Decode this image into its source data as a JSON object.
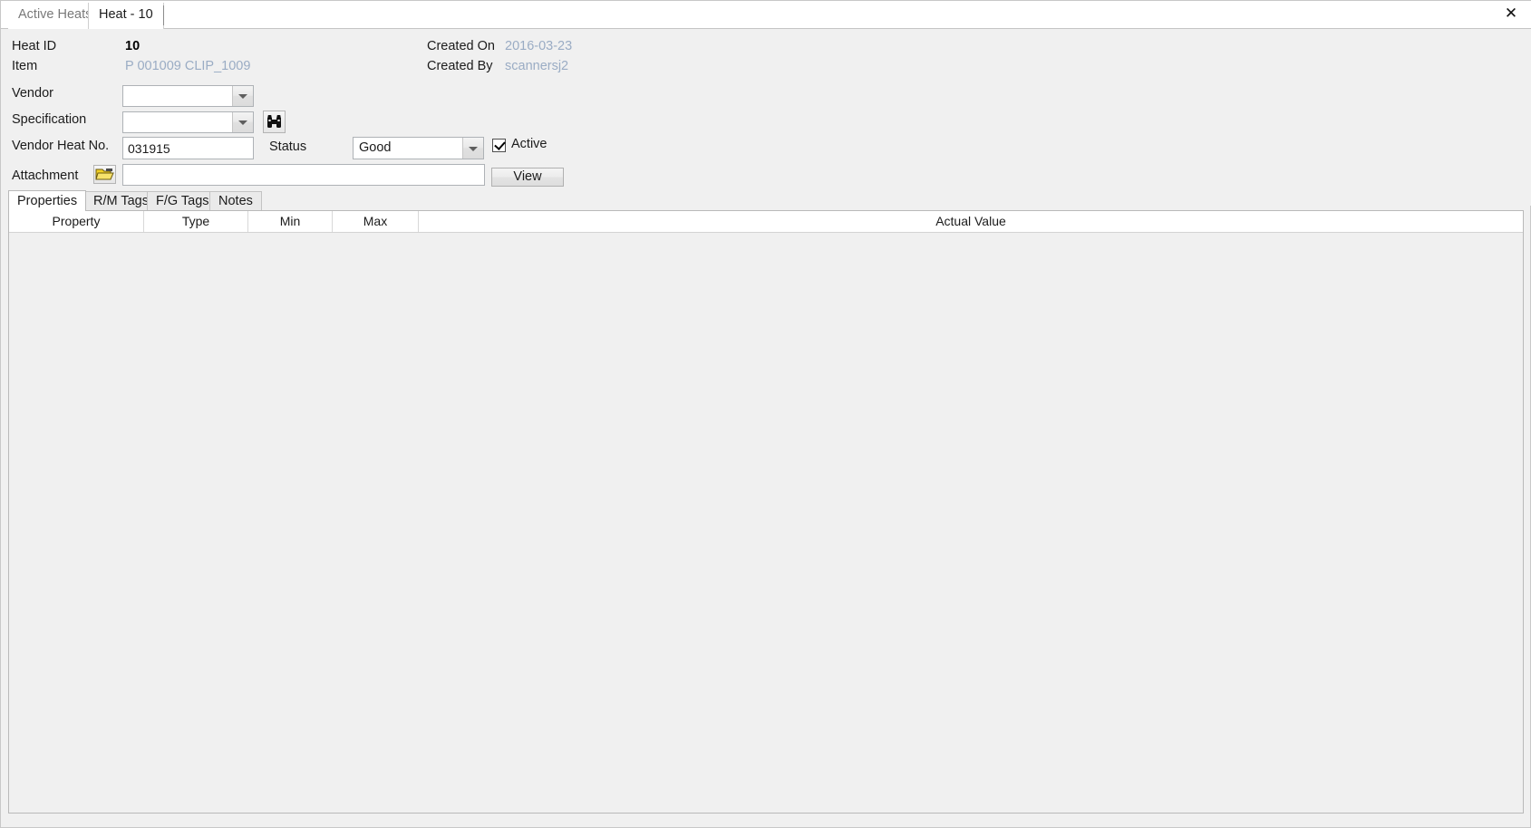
{
  "window": {
    "close_label": "✕"
  },
  "doc_tabs": [
    {
      "label": "Active Heats",
      "active": false
    },
    {
      "label": "Heat - 10",
      "active": true
    }
  ],
  "header": {
    "heat_id_label": "Heat ID",
    "heat_id_value": "10",
    "item_label": "Item",
    "item_value": "P 001009 CLIP_1009",
    "created_on_label": "Created On",
    "created_on_value": "2016-03-23",
    "created_by_label": "Created By",
    "created_by_value": "scannersj2"
  },
  "form": {
    "vendor_label": "Vendor",
    "vendor_value": "",
    "specification_label": "Specification",
    "specification_value": "",
    "specification_search_icon": "binoculars-icon",
    "vendor_heat_no_label": "Vendor Heat No.",
    "vendor_heat_no_value": "031915",
    "status_label": "Status",
    "status_value": "Good",
    "active_label": "Active",
    "active_checked": true,
    "attachment_label": "Attachment",
    "attachment_browse_icon": "open-folder-icon",
    "attachment_value": "",
    "view_label": "View"
  },
  "inner_tabs": [
    {
      "label": "Properties",
      "active": true
    },
    {
      "label": "R/M Tags",
      "active": false
    },
    {
      "label": "F/G Tags",
      "active": false
    },
    {
      "label": "Notes",
      "active": false
    }
  ],
  "grid": {
    "columns": [
      {
        "label": "Property"
      },
      {
        "label": "Type"
      },
      {
        "label": "Min"
      },
      {
        "label": "Max"
      },
      {
        "label": "Actual Value"
      }
    ],
    "rows": []
  },
  "colors": {
    "window_bg": "#f0f0f0",
    "tab_bg": "#ffffff",
    "link_text": "#9aacc4",
    "text": "#1b1b1b",
    "border": "#b9b9b9",
    "folder_icon": "#f2d024"
  }
}
